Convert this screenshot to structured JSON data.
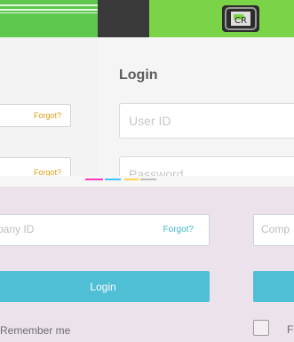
{
  "back_window": {
    "forgot_1": "Forgot?",
    "forgot_2": "Forgot?"
  },
  "front_window": {
    "title": "Login",
    "user_id_placeholder": "User ID",
    "password_placeholder": "Password"
  },
  "bottom_form": {
    "company_id_placeholder": "pany ID",
    "forgot": "Forgot?",
    "login_button": "Login",
    "remember_me": "Remember me",
    "right_company_placeholder": "Comp",
    "right_label": "F"
  },
  "logo": {
    "text": "CR"
  },
  "colors": {
    "green_bar": "#5ec84e",
    "login_button": "#4fbfd6",
    "forgot_link": "#46b7cf"
  }
}
